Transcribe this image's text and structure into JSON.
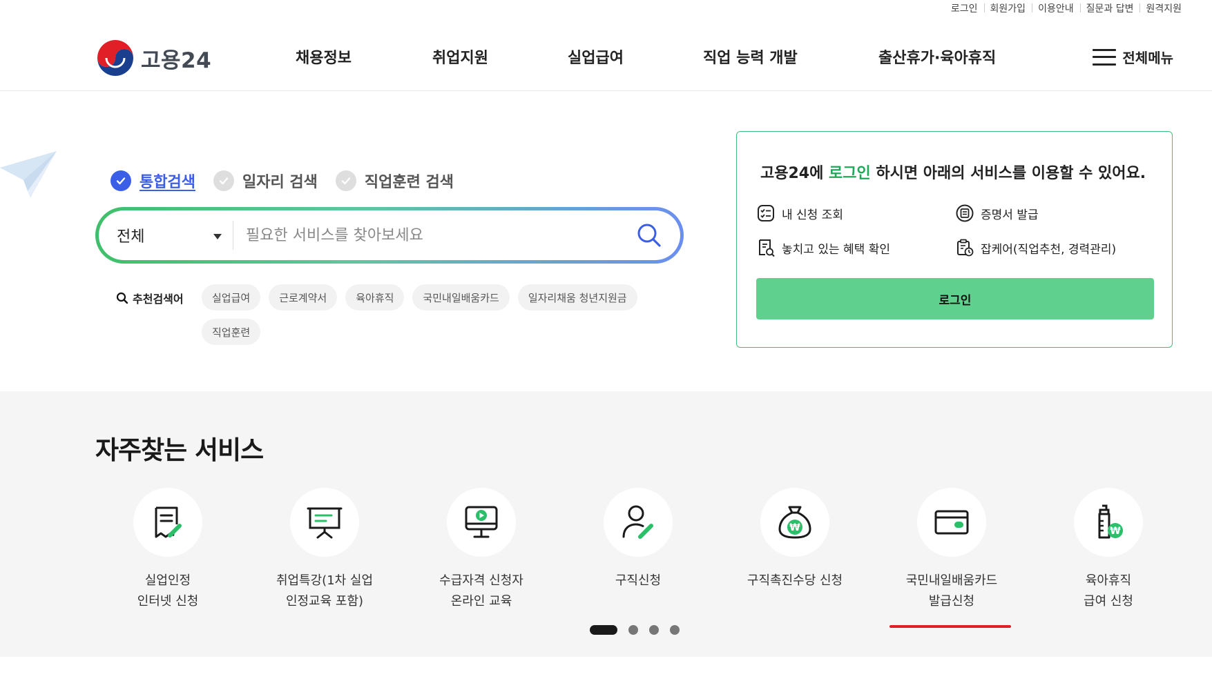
{
  "util_links": [
    "로그인",
    "회원가입",
    "이용안내",
    "질문과 답변",
    "원격지원"
  ],
  "logo": {
    "text": "고용24"
  },
  "gnb": [
    "채용정보",
    "취업지원",
    "실업급여",
    "직업 능력 개발",
    "출산휴가·육아휴직"
  ],
  "all_menu": {
    "label": "전체메뉴",
    "icon": "hamburger-icon"
  },
  "search": {
    "tabs": [
      {
        "label": "통합검색",
        "active": true
      },
      {
        "label": "일자리 검색",
        "active": false
      },
      {
        "label": "직업훈련 검색",
        "active": false
      }
    ],
    "category": "전체",
    "placeholder": "필요한 서비스를 찾아보세요",
    "gradient_colors": [
      "#3fbf6b",
      "#6b8ef0"
    ]
  },
  "recommended": {
    "label": "추천검색어",
    "keywords": [
      "실업급여",
      "근로계약서",
      "육아휴직",
      "국민내일배움카드",
      "일자리채움 청년지원금",
      "직업훈련"
    ]
  },
  "login_card": {
    "title_pre": "고용24에 ",
    "title_highlight": "로그인",
    "title_post": " 하시면 아래의 서비스를 이용할 수 있어요.",
    "services": [
      {
        "label": "내 신청 조회",
        "icon": "checklist-icon"
      },
      {
        "label": "증명서 발급",
        "icon": "certificate-icon"
      },
      {
        "label": "놓치고 있는 혜택 확인",
        "icon": "benefit-search-icon"
      },
      {
        "label": "잡케어(직업추천, 경력관리)",
        "icon": "jobcare-icon"
      }
    ],
    "button": "로그인",
    "accent": "#5fd08d"
  },
  "frequent": {
    "title": "자주찾는 서비스",
    "items": [
      {
        "label": "실업인정\n인터넷 신청",
        "icon": "document-edit-icon"
      },
      {
        "label": "취업특강(1차 실업\n인정교육 포함)",
        "icon": "presentation-board-icon"
      },
      {
        "label": "수급자격 신청자\n온라인 교육",
        "icon": "monitor-play-icon"
      },
      {
        "label": "구직신청",
        "icon": "person-edit-icon"
      },
      {
        "label": "구직촉진수당 신청",
        "icon": "money-bag-icon"
      },
      {
        "label": "국민내일배움카드\n발급신청",
        "icon": "card-icon"
      },
      {
        "label": "육아휴직\n급여 신청",
        "icon": "baby-bottle-won-icon"
      }
    ],
    "pagination": {
      "total": 4,
      "current": 1
    }
  }
}
